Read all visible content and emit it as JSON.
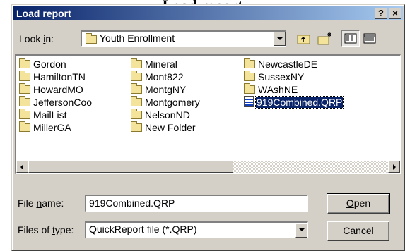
{
  "page": {
    "title": "Load report"
  },
  "dialog": {
    "title": "Load report",
    "help_label": "?",
    "close_label": "×",
    "look_in": {
      "label_pre": "Look ",
      "label_key": "i",
      "label_post": "n:",
      "value": "Youth Enrollment"
    },
    "toolbar": {
      "up_folder": "up-one-level",
      "new_folder": "create-new-folder",
      "list_view": "list-view",
      "details_view": "details-view"
    },
    "files": [
      {
        "name": "Gordon",
        "type": "folder"
      },
      {
        "name": "HamiltonTN",
        "type": "folder"
      },
      {
        "name": "HowardMO",
        "type": "folder"
      },
      {
        "name": "JeffersonCoo",
        "type": "folder"
      },
      {
        "name": "MailList",
        "type": "folder"
      },
      {
        "name": "MillerGA",
        "type": "folder"
      },
      {
        "name": "Mineral",
        "type": "folder"
      },
      {
        "name": "Mont822",
        "type": "folder"
      },
      {
        "name": "MontgNY",
        "type": "folder"
      },
      {
        "name": "Montgomery",
        "type": "folder"
      },
      {
        "name": "NelsonND",
        "type": "folder"
      },
      {
        "name": "New Folder",
        "type": "folder"
      },
      {
        "name": "NewcastleDE",
        "type": "folder"
      },
      {
        "name": "SussexNY",
        "type": "folder"
      },
      {
        "name": "WAshNE",
        "type": "folder"
      },
      {
        "name": "919Combined.QRP",
        "type": "file",
        "selected": true
      }
    ],
    "file_name": {
      "label_pre": "File ",
      "label_key": "n",
      "label_post": "ame:",
      "value": "919Combined.QRP"
    },
    "file_type": {
      "label_pre": "Files of ",
      "label_key": "t",
      "label_post": "ype:",
      "value": "QuickReport file (*.QRP)"
    },
    "open_button": {
      "key": "O",
      "rest": "pen"
    },
    "cancel_button": "Cancel",
    "colors": {
      "titlebar_start": "#0a246a",
      "titlebar_end": "#a6caf0",
      "face": "#d4d0c8",
      "selection": "#0a246a"
    }
  }
}
